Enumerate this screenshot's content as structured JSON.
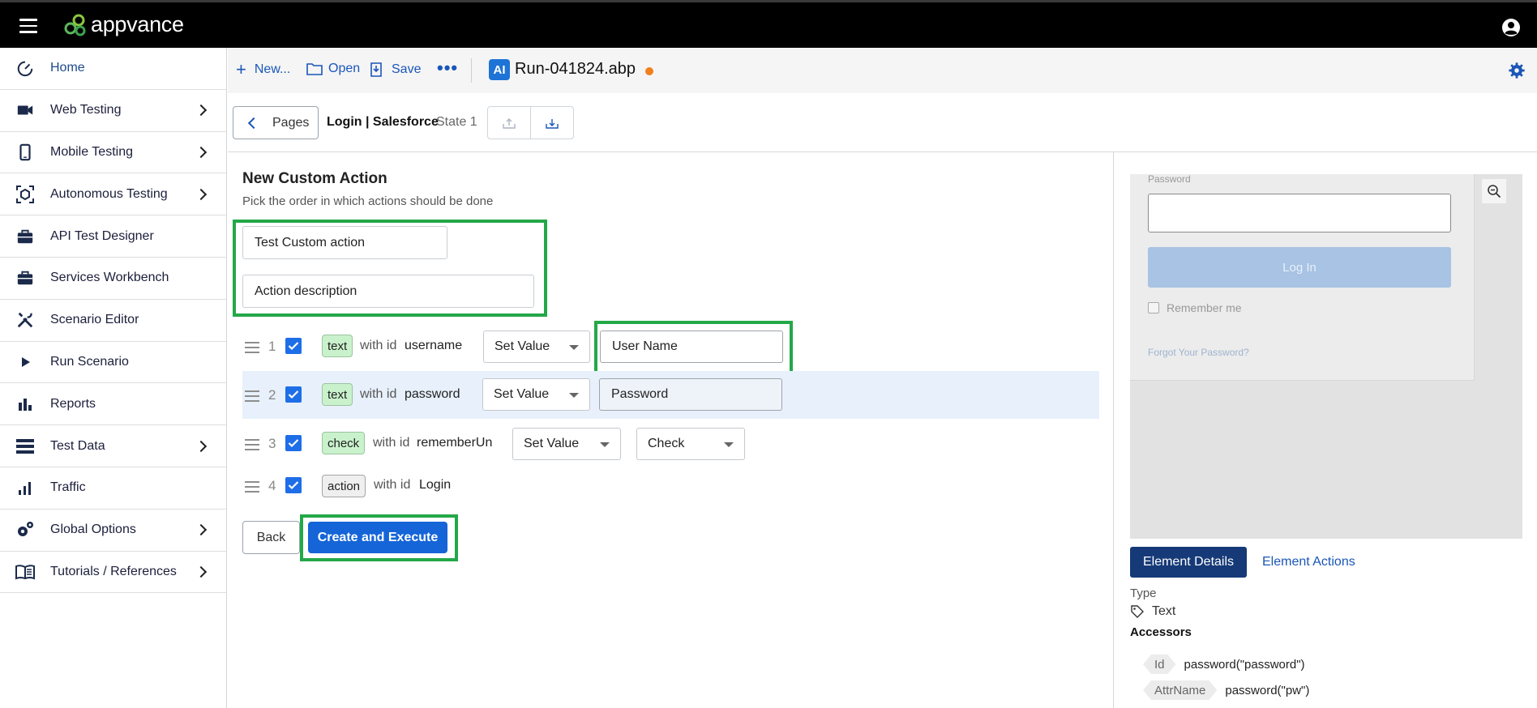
{
  "app": {
    "logo_text": "appvance"
  },
  "sidebar": {
    "items": [
      {
        "label": "Home",
        "icon": "dashboard-gauge-icon",
        "has_submenu": false
      },
      {
        "label": "Web Testing",
        "icon": "video-camera-icon",
        "has_submenu": true
      },
      {
        "label": "Mobile Testing",
        "icon": "mobile-phone-icon",
        "has_submenu": true
      },
      {
        "label": "Autonomous Testing",
        "icon": "cube-scan-icon",
        "has_submenu": true
      },
      {
        "label": "API Test Designer",
        "icon": "briefcase-icon",
        "has_submenu": false
      },
      {
        "label": "Services Workbench",
        "icon": "briefcase-icon",
        "has_submenu": false
      },
      {
        "label": "Scenario Editor",
        "icon": "tools-icon",
        "has_submenu": false
      },
      {
        "label": "Run Scenario",
        "icon": "play-icon",
        "has_submenu": false
      },
      {
        "label": "Reports",
        "icon": "bar-chart-icon",
        "has_submenu": false
      },
      {
        "label": "Test Data",
        "icon": "list-storage-icon",
        "has_submenu": true
      },
      {
        "label": "Traffic",
        "icon": "bar-chart-small-icon",
        "has_submenu": false
      },
      {
        "label": "Global Options",
        "icon": "gears-icon",
        "has_submenu": true
      },
      {
        "label": "Tutorials / References",
        "icon": "book-icon",
        "has_submenu": true
      }
    ]
  },
  "toolbar": {
    "new_label": "New...",
    "open_label": "Open",
    "save_label": "Save",
    "ai_badge": "AI",
    "file_name": "Run-041824.abp"
  },
  "breadcrumb": {
    "pages_label": "Pages",
    "page_title": "Login | Salesforce",
    "state_label": "State 1"
  },
  "form": {
    "title": "New Custom Action",
    "subtitle": "Pick the order in which actions should be done",
    "name_value": "Test Custom action",
    "description_value": "Action description",
    "with_id_label": "with id",
    "rows": [
      {
        "num": "1",
        "tag": "text",
        "id": "username",
        "action": "Set Value",
        "value": "User Name"
      },
      {
        "num": "2",
        "tag": "text",
        "id": "password",
        "action": "Set Value",
        "value": "Password"
      },
      {
        "num": "3",
        "tag": "check",
        "id": "rememberUn",
        "action": "Set Value",
        "value": "Check"
      },
      {
        "num": "4",
        "tag": "action",
        "id": "Login"
      }
    ],
    "back_label": "Back",
    "create_label": "Create and Execute"
  },
  "preview": {
    "password_label": "Password",
    "login_button": "Log In",
    "remember_label": "Remember me",
    "forgot_link": "Forgot Your Password?"
  },
  "details": {
    "tab_active": "Element Details",
    "tab_other": "Element Actions",
    "type_label": "Type",
    "type_value": "Text",
    "accessors_label": "Accessors",
    "accessors": [
      {
        "key": "Id",
        "value": "password(\"password\")"
      },
      {
        "key": "AttrName",
        "value": "password(\"pw\")"
      }
    ]
  },
  "colors": {
    "highlight_green": "#23a848",
    "primary_blue": "#1565d8",
    "dirty_indicator": "#f07f1d"
  }
}
